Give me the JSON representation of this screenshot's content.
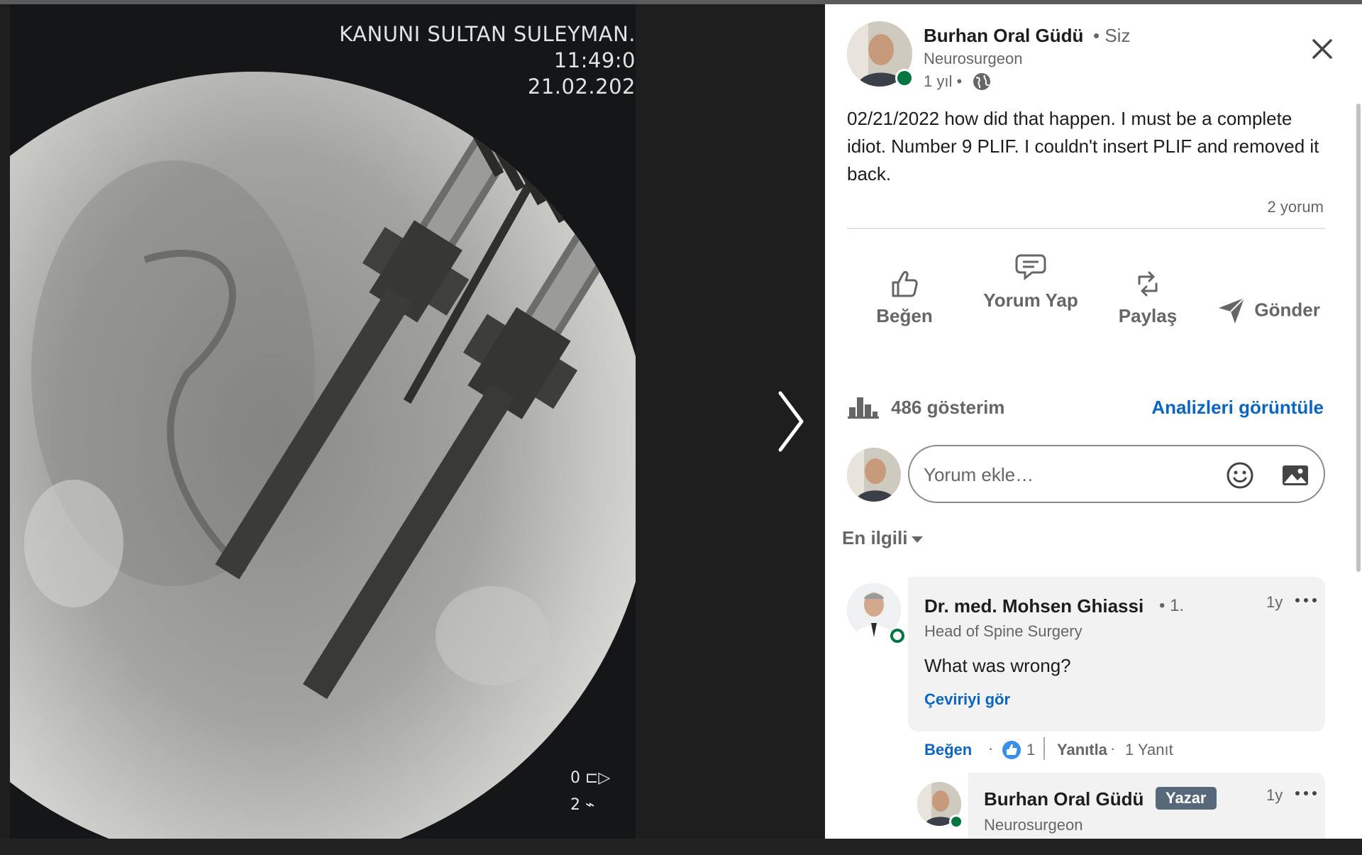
{
  "image_overlay": {
    "hospital": "KANUNI SULTAN SULEYMAN.",
    "time": "11:49:0",
    "date": "21.02.202",
    "icon_label_1": "0",
    "icon_label_2": "2"
  },
  "viewer": {
    "next_icon": "chevron-right-icon"
  },
  "post": {
    "author_name": "Burhan Oral Güdü",
    "author_relation": "• Siz",
    "author_title": "Neurosurgeon",
    "time": "1 yıl •",
    "visibility_icon": "globe-icon",
    "text": "02/21/2022 how did that happen. I must be a complete idiot. Number 9 PLIF. I couldn't insert PLIF and removed it back.",
    "comment_count": "2 yorum",
    "close_icon": "close-icon"
  },
  "actions": {
    "like": "Beğen",
    "comment": "Yorum Yap",
    "share": "Paylaş",
    "send": "Gönder"
  },
  "stats": {
    "impressions": "486 gösterim",
    "analytics_link": "Analizleri görüntüle"
  },
  "comment_box": {
    "placeholder": "Yorum ekle…"
  },
  "sort": {
    "label": "En ilgili"
  },
  "comments": [
    {
      "name": "Dr. med. Mohsen Ghiassi",
      "degree": "• 1.",
      "time": "1y",
      "title": "Head of Spine Surgery",
      "text": "What was wrong?",
      "translate": "Çeviriyi gör",
      "like": "Beğen",
      "dot": "·",
      "reaction_count": "1",
      "reply": "Yanıtla",
      "dot2": "·",
      "replies": "1 Yanıt"
    },
    {
      "name": "Burhan Oral Güdü",
      "badge": "Yazar",
      "time": "1y",
      "title": "Neurosurgeon"
    }
  ],
  "colors": {
    "link_blue": "#0a66c2",
    "online_green": "#057642",
    "badge_gray": "#56687a",
    "text_dark": "#1d1d1d",
    "text_muted": "#666666"
  }
}
